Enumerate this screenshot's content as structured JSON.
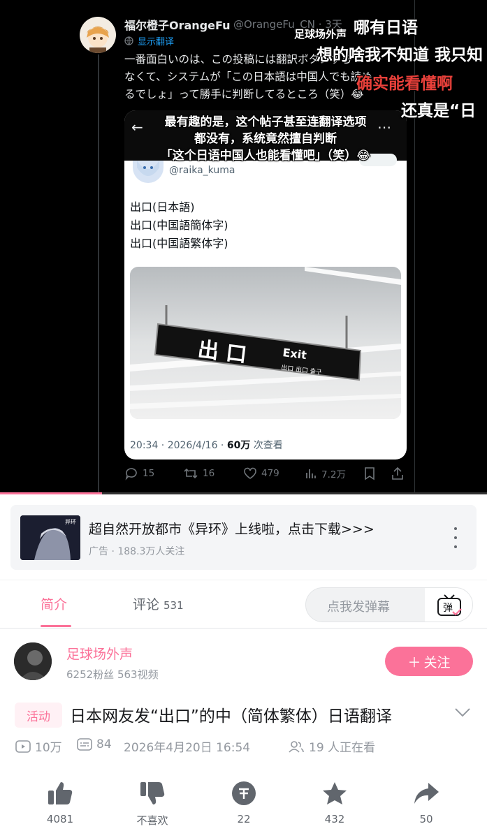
{
  "tweet": {
    "display_name": "福尔橙子OrangeFu",
    "handle_time": "@OrangeFu_CN · 3天",
    "translate_label": "显示翻译",
    "body_lines": [
      "一番面白いのは、この投稿には翻訳ボタンすら",
      "なくて、システムが「この日本語は中国人でも読め",
      "るでしょ」って勝手に判断してるところ（笑）😂"
    ],
    "actions": {
      "replies": "15",
      "retweets": "16",
      "likes": "479",
      "views": "7.2万"
    }
  },
  "danmaku": [
    {
      "text": "足球场外声",
      "color": "#ffffff"
    },
    {
      "text": "哪有日语",
      "color": "#ffffff"
    },
    {
      "text": "想的啥我不知道 我只知",
      "color": "#ffffff"
    },
    {
      "text": "确实能看懂啊",
      "color": "#e8403a"
    },
    {
      "text": "还真是“日",
      "color": "#ffffff"
    }
  ],
  "subtitle": {
    "line1": "最有趣的是，这个帖子甚至连翻译选项",
    "line2": "都没有，系统竟然擅自判断",
    "line3": "「这个日语中国人也能看懂吧」（笑）😂"
  },
  "quoted": {
    "handle": "@raika_kuma",
    "lines": [
      "出口(日本語)",
      "出口(中国語簡体字)",
      "出口(中国語繁体字)"
    ],
    "sign_main": "出 口",
    "sign_exit": "Exit",
    "sign_small": "出口  出口  출구",
    "time_date": "20:34 · 2026/4/16 · ",
    "views_num": "60万",
    "views_label": " 次查看"
  },
  "player": {
    "progress": 0.21
  },
  "ad": {
    "thumb_label": "异环",
    "title": "超自然开放都市《异环》上线啦，点击下载>>>",
    "subtitle": "广告 · 188.3万人关注"
  },
  "tabs": {
    "intro": "简介",
    "comments": "评论",
    "comments_count": "531",
    "danmaku_placeholder": "点我发弹幕",
    "danmaku_btn": "弹"
  },
  "uploader": {
    "name": "足球场外声",
    "stats": "6252粉丝   563视频",
    "follow": "关注"
  },
  "video": {
    "tag": "活动",
    "title": "日本网友发“出口”的中（简体繁体）日语翻译",
    "plays": "10万",
    "danmaku_count": "84",
    "date": "2026年4月20日 16:54",
    "watching": "19 人正在看"
  },
  "action_bar": {
    "like": "4081",
    "dislike": "不喜欢",
    "coin": "22",
    "favorite": "432",
    "share": "50"
  },
  "colors": {
    "accent": "#fb7299",
    "twitter_blue": "#1d9bf0"
  }
}
